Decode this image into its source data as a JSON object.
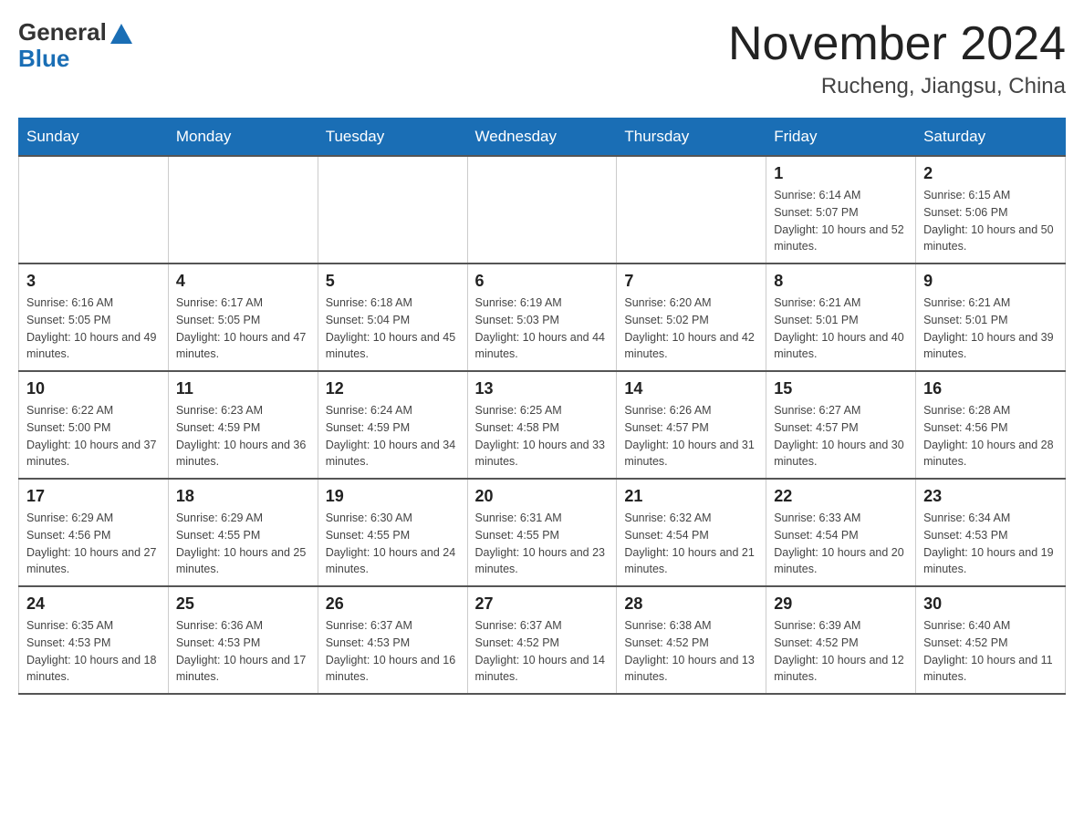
{
  "logo": {
    "general": "General",
    "blue": "Blue"
  },
  "title": "November 2024",
  "location": "Rucheng, Jiangsu, China",
  "days_of_week": [
    "Sunday",
    "Monday",
    "Tuesday",
    "Wednesday",
    "Thursday",
    "Friday",
    "Saturday"
  ],
  "weeks": [
    [
      {
        "day": "",
        "info": ""
      },
      {
        "day": "",
        "info": ""
      },
      {
        "day": "",
        "info": ""
      },
      {
        "day": "",
        "info": ""
      },
      {
        "day": "",
        "info": ""
      },
      {
        "day": "1",
        "info": "Sunrise: 6:14 AM\nSunset: 5:07 PM\nDaylight: 10 hours and 52 minutes."
      },
      {
        "day": "2",
        "info": "Sunrise: 6:15 AM\nSunset: 5:06 PM\nDaylight: 10 hours and 50 minutes."
      }
    ],
    [
      {
        "day": "3",
        "info": "Sunrise: 6:16 AM\nSunset: 5:05 PM\nDaylight: 10 hours and 49 minutes."
      },
      {
        "day": "4",
        "info": "Sunrise: 6:17 AM\nSunset: 5:05 PM\nDaylight: 10 hours and 47 minutes."
      },
      {
        "day": "5",
        "info": "Sunrise: 6:18 AM\nSunset: 5:04 PM\nDaylight: 10 hours and 45 minutes."
      },
      {
        "day": "6",
        "info": "Sunrise: 6:19 AM\nSunset: 5:03 PM\nDaylight: 10 hours and 44 minutes."
      },
      {
        "day": "7",
        "info": "Sunrise: 6:20 AM\nSunset: 5:02 PM\nDaylight: 10 hours and 42 minutes."
      },
      {
        "day": "8",
        "info": "Sunrise: 6:21 AM\nSunset: 5:01 PM\nDaylight: 10 hours and 40 minutes."
      },
      {
        "day": "9",
        "info": "Sunrise: 6:21 AM\nSunset: 5:01 PM\nDaylight: 10 hours and 39 minutes."
      }
    ],
    [
      {
        "day": "10",
        "info": "Sunrise: 6:22 AM\nSunset: 5:00 PM\nDaylight: 10 hours and 37 minutes."
      },
      {
        "day": "11",
        "info": "Sunrise: 6:23 AM\nSunset: 4:59 PM\nDaylight: 10 hours and 36 minutes."
      },
      {
        "day": "12",
        "info": "Sunrise: 6:24 AM\nSunset: 4:59 PM\nDaylight: 10 hours and 34 minutes."
      },
      {
        "day": "13",
        "info": "Sunrise: 6:25 AM\nSunset: 4:58 PM\nDaylight: 10 hours and 33 minutes."
      },
      {
        "day": "14",
        "info": "Sunrise: 6:26 AM\nSunset: 4:57 PM\nDaylight: 10 hours and 31 minutes."
      },
      {
        "day": "15",
        "info": "Sunrise: 6:27 AM\nSunset: 4:57 PM\nDaylight: 10 hours and 30 minutes."
      },
      {
        "day": "16",
        "info": "Sunrise: 6:28 AM\nSunset: 4:56 PM\nDaylight: 10 hours and 28 minutes."
      }
    ],
    [
      {
        "day": "17",
        "info": "Sunrise: 6:29 AM\nSunset: 4:56 PM\nDaylight: 10 hours and 27 minutes."
      },
      {
        "day": "18",
        "info": "Sunrise: 6:29 AM\nSunset: 4:55 PM\nDaylight: 10 hours and 25 minutes."
      },
      {
        "day": "19",
        "info": "Sunrise: 6:30 AM\nSunset: 4:55 PM\nDaylight: 10 hours and 24 minutes."
      },
      {
        "day": "20",
        "info": "Sunrise: 6:31 AM\nSunset: 4:55 PM\nDaylight: 10 hours and 23 minutes."
      },
      {
        "day": "21",
        "info": "Sunrise: 6:32 AM\nSunset: 4:54 PM\nDaylight: 10 hours and 21 minutes."
      },
      {
        "day": "22",
        "info": "Sunrise: 6:33 AM\nSunset: 4:54 PM\nDaylight: 10 hours and 20 minutes."
      },
      {
        "day": "23",
        "info": "Sunrise: 6:34 AM\nSunset: 4:53 PM\nDaylight: 10 hours and 19 minutes."
      }
    ],
    [
      {
        "day": "24",
        "info": "Sunrise: 6:35 AM\nSunset: 4:53 PM\nDaylight: 10 hours and 18 minutes."
      },
      {
        "day": "25",
        "info": "Sunrise: 6:36 AM\nSunset: 4:53 PM\nDaylight: 10 hours and 17 minutes."
      },
      {
        "day": "26",
        "info": "Sunrise: 6:37 AM\nSunset: 4:53 PM\nDaylight: 10 hours and 16 minutes."
      },
      {
        "day": "27",
        "info": "Sunrise: 6:37 AM\nSunset: 4:52 PM\nDaylight: 10 hours and 14 minutes."
      },
      {
        "day": "28",
        "info": "Sunrise: 6:38 AM\nSunset: 4:52 PM\nDaylight: 10 hours and 13 minutes."
      },
      {
        "day": "29",
        "info": "Sunrise: 6:39 AM\nSunset: 4:52 PM\nDaylight: 10 hours and 12 minutes."
      },
      {
        "day": "30",
        "info": "Sunrise: 6:40 AM\nSunset: 4:52 PM\nDaylight: 10 hours and 11 minutes."
      }
    ]
  ]
}
